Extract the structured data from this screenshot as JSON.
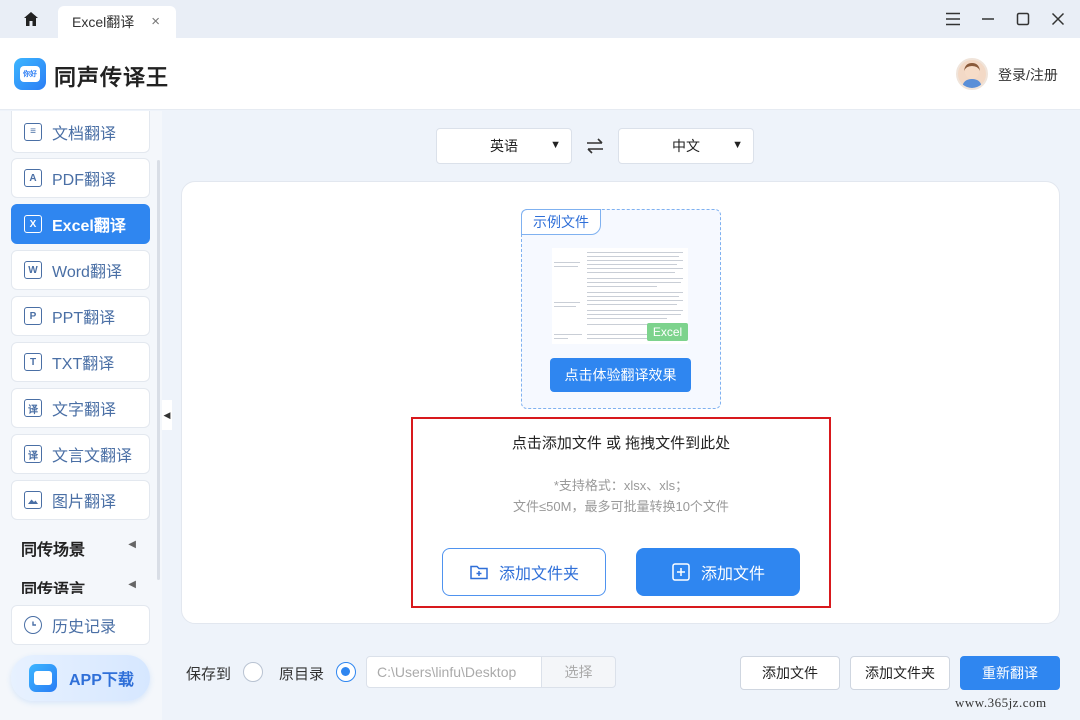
{
  "titlebar": {
    "tab_label": "Excel翻译",
    "tab_close": "×"
  },
  "header": {
    "app_name": "同声传译王",
    "logo_text": "你好\nHi",
    "login_label": "登录/注册"
  },
  "sidebar": {
    "items": [
      {
        "label": "文档翻译",
        "icon": "document-icon",
        "glyph": ""
      },
      {
        "label": "PDF翻译",
        "icon": "pdf-icon",
        "glyph": "A"
      },
      {
        "label": "Excel翻译",
        "icon": "excel-icon",
        "glyph": "X"
      },
      {
        "label": "Word翻译",
        "icon": "word-icon",
        "glyph": "W"
      },
      {
        "label": "PPT翻译",
        "icon": "ppt-icon",
        "glyph": "P"
      },
      {
        "label": "TXT翻译",
        "icon": "txt-icon",
        "glyph": "T"
      },
      {
        "label": "文字翻译",
        "icon": "text-translate-icon",
        "glyph": "译"
      },
      {
        "label": "文言文翻译",
        "icon": "classical-chinese-icon",
        "glyph": "译"
      },
      {
        "label": "图片翻译",
        "icon": "image-icon",
        "glyph": ""
      }
    ],
    "sections": [
      {
        "label": "同传场景"
      },
      {
        "label": "同传语言"
      }
    ],
    "history_label": "历史记录",
    "app_download_label": "APP下载"
  },
  "language": {
    "source": "英语",
    "target": "中文",
    "caret": "▼"
  },
  "main": {
    "sample_tag": "示例文件",
    "excel_badge": "Excel",
    "try_button": "点击体验翻译效果",
    "drop_title": "点击添加文件 或 拖拽文件到此处",
    "hint_formats": "*支持格式：xlsx、xls；",
    "hint_limits": "文件≤50M，最多可批量转换10个文件",
    "add_folder_button": "添加文件夹",
    "add_file_button": "添加文件"
  },
  "bottom": {
    "save_to_label": "保存到",
    "original_dir_label": "原目录",
    "path_placeholder": "C:\\Users\\linfu\\Desktop",
    "choose_button": "选择",
    "add_file_button": "添加文件",
    "add_folder_button": "添加文件夹",
    "retranslate_button": "重新翻译",
    "selected_option": "原目录"
  },
  "watermark": "www.365jz.com",
  "colors": {
    "accent": "#2f86f0",
    "highlight_border": "#d8191d",
    "excel_green": "#7dd38d"
  }
}
